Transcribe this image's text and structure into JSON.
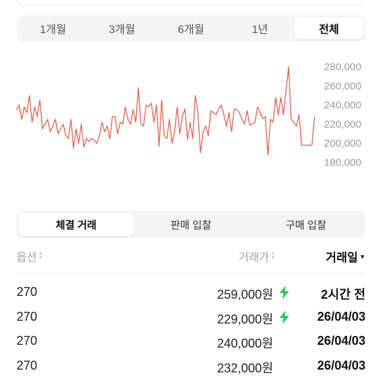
{
  "period_tabs": [
    {
      "label": "1개월",
      "active": false
    },
    {
      "label": "3개월",
      "active": false
    },
    {
      "label": "6개월",
      "active": false
    },
    {
      "label": "1년",
      "active": false
    },
    {
      "label": "전체",
      "active": true
    }
  ],
  "chart_data": {
    "type": "line",
    "series": [
      {
        "color": "#e0604e",
        "x": [
          0,
          1,
          2,
          3,
          4,
          5,
          6,
          7,
          8,
          9,
          10,
          11,
          12,
          13,
          14,
          15,
          16,
          17,
          18,
          19,
          20,
          21,
          22,
          23,
          24,
          25,
          26,
          27,
          28,
          29,
          30,
          31,
          32,
          33,
          34,
          35,
          36,
          37,
          38,
          39,
          40,
          41,
          42,
          43,
          44,
          45,
          46,
          47,
          48,
          49,
          50,
          51,
          52,
          53,
          54,
          55,
          56,
          57,
          58,
          59,
          60,
          61,
          62,
          63,
          64,
          65,
          66,
          67,
          68,
          69,
          70,
          71,
          72,
          73,
          74,
          75,
          76,
          77,
          78,
          79,
          80,
          81,
          82,
          83,
          84,
          85,
          86,
          87,
          88,
          89,
          90,
          91,
          92,
          93,
          94,
          95,
          96,
          97,
          98,
          99,
          100,
          101,
          102,
          103,
          104,
          105,
          106,
          107,
          108,
          109
        ],
        "values": [
          235000,
          240000,
          225000,
          238000,
          232000,
          250000,
          222000,
          238000,
          228000,
          245000,
          215000,
          220000,
          225000,
          212000,
          218000,
          225000,
          210000,
          215000,
          220000,
          208000,
          205000,
          225000,
          195000,
          215000,
          200000,
          220000,
          196000,
          205000,
          202000,
          205000,
          203000,
          200000,
          208000,
          222000,
          212000,
          218000,
          205000,
          228000,
          228000,
          210000,
          222000,
          220000,
          238000,
          225000,
          220000,
          235000,
          222000,
          258000,
          220000,
          218000,
          240000,
          238000,
          242000,
          222000,
          240000,
          197000,
          245000,
          208000,
          205000,
          225000,
          200000,
          212000,
          238000,
          210000,
          228000,
          236000,
          204000,
          222000,
          205000,
          250000,
          232000,
          190000,
          212000,
          218000,
          208000,
          234000,
          232000,
          230000,
          236000,
          240000,
          230000,
          218000,
          232000,
          212000,
          236000,
          235000,
          232000,
          225000,
          220000,
          234000,
          219000,
          220000,
          222000,
          238000,
          232000,
          226000,
          228000,
          188000,
          225000,
          222000,
          248000,
          230000,
          248000,
          230000,
          255000,
          280000,
          225000,
          222000,
          218000,
          230000
        ],
        "tail": {
          "x": [
            109,
            110,
            111,
            112,
            113,
            114,
            115
          ],
          "values": [
            230000,
            198000,
            198000,
            198000,
            198000,
            198000,
            228000
          ]
        }
      }
    ],
    "ylim": [
      180000,
      280000
    ],
    "y_ticks": [
      "280,000",
      "260,000",
      "240,000",
      "220,000",
      "200,000",
      "180,000"
    ],
    "grid": false,
    "xlabel": "",
    "ylabel": ""
  },
  "trade_tabs": [
    {
      "label": "체결 거래",
      "active": true
    },
    {
      "label": "판매 입찰",
      "active": false
    },
    {
      "label": "구매 입찰",
      "active": false
    }
  ],
  "table": {
    "headers": {
      "option": "옵션",
      "price": "거래가",
      "date": "거래일"
    },
    "sorted_by": "date",
    "rows": [
      {
        "option": "270",
        "price": "259,000원",
        "fast": true,
        "date": "2시간 전"
      },
      {
        "option": "270",
        "price": "229,000원",
        "fast": true,
        "date": "26/04/03"
      },
      {
        "option": "270",
        "price": "240,000원",
        "fast": false,
        "date": "26/04/03"
      },
      {
        "option": "270",
        "price": "232,000원",
        "fast": false,
        "date": "26/04/03"
      }
    ]
  },
  "colors": {
    "line": "#e0604e",
    "bolt": "#2ec35c",
    "muted": "#a3a3a3"
  },
  "icons": {
    "bolt": "lightning-bolt-icon",
    "sort": "sort-arrows-icon"
  }
}
